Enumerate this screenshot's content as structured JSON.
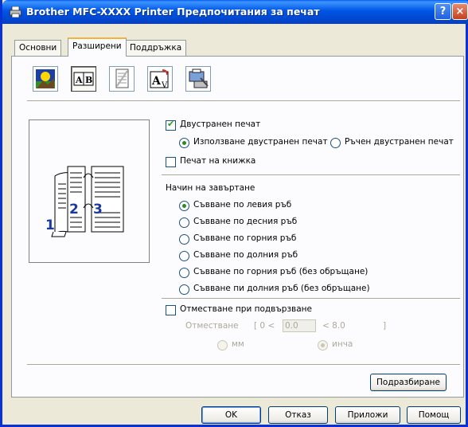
{
  "window": {
    "title": "Brother MFC-XXXX Printer Предпочитания за печат",
    "help_button": "?",
    "close_button": "×"
  },
  "tabs": [
    {
      "label": "Основни",
      "active": false
    },
    {
      "label": "Разширени",
      "active": true
    },
    {
      "label": "Поддръжка",
      "active": false
    }
  ],
  "toolbar_icons": [
    "print-quality-icon",
    "duplex-booklet-icon",
    "watermark-icon",
    "page-setting-icon",
    "device-options-icon"
  ],
  "preview": {
    "page_numbers": [
      "1",
      "2",
      "3"
    ]
  },
  "duplex": {
    "label": "Двустранен печат",
    "checked": true,
    "option_auto": "Използване двустранен печат",
    "option_manual": "Ръчен двустранен печат",
    "selected": "auto"
  },
  "booklet": {
    "label": "Печат на книжка",
    "checked": false
  },
  "binding": {
    "title": "Начин на завъртане",
    "options": [
      "Съвване по левия ръб",
      "Съвване по десния ръб",
      "Съвване по горния ръб",
      "Съвване по долния ръб",
      "Съвване по горния ръб (без обръщане)",
      "Съвване пи долния ръб (без обръщане)"
    ],
    "selected_index": 0
  },
  "offset": {
    "checkbox_label": "Отместване при подвързване",
    "checked": false,
    "field_label": "Отместване",
    "range_open": "[ 0 <",
    "value": "0.0",
    "range_close": "<  8.0",
    "bracket": "]",
    "unit_mm": "мм",
    "unit_inch": "инча",
    "selected_unit": "inch"
  },
  "buttons": {
    "default": "Подразбиране",
    "ok": "OK",
    "cancel": "Отказ",
    "apply": "Приложи",
    "help": "Помощ"
  }
}
